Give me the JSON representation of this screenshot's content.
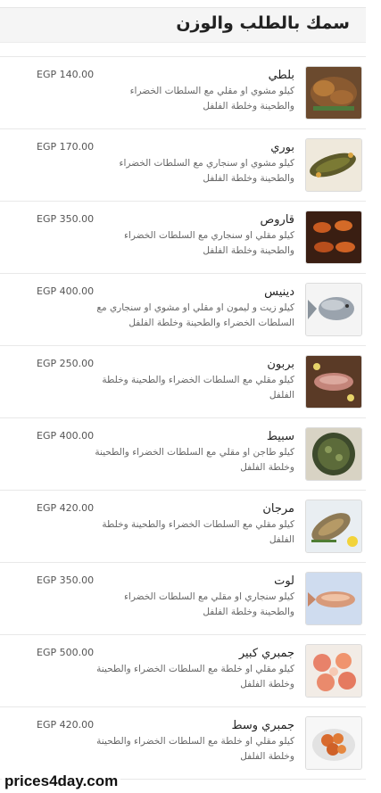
{
  "section": {
    "title": "سمك بالطلب والوزن"
  },
  "items": [
    {
      "name": "بلطي",
      "desc": "كيلو مشوي او مقلي مع السلطات الخضراء والطحينة وخلطة الفلفل",
      "price": "EGP 140.00",
      "icon": "tilapia-photo"
    },
    {
      "name": "بوري",
      "desc": "كيلو مشوي او سنجاري مع السلطات الخضراء والطحينة وخلطة الفلفل",
      "price": "EGP 170.00",
      "icon": "mullet-photo"
    },
    {
      "name": "قاروص",
      "desc": "كيلو مقلي او سنجاري مع السلطات الخضراء والطحينة وخلطة الفلفل",
      "price": "EGP 350.00",
      "icon": "seabass-photo"
    },
    {
      "name": "دينيس",
      "desc": "كيلو زيت و ليمون او مقلي او مشوي او سنجاري مع السلطات الخضراء والطحينة وخلطة الفلفل",
      "price": "EGP 400.00",
      "icon": "sea-bream-photo"
    },
    {
      "name": "بربون",
      "desc": "كيلو مقلي مع السلطات الخضراء والطحينة وخلطة الفلفل",
      "price": "EGP 250.00",
      "icon": "red-mullet-photo"
    },
    {
      "name": "سبيط",
      "desc": "كيلو طاجن او مقلي مع السلطات الخضراء والطحينة وخلطة الفلفل",
      "price": "EGP 400.00",
      "icon": "squid-photo"
    },
    {
      "name": "مرجان",
      "desc": "كيلو مقلي مع السلطات الخضراء والطحينة وخلطة الفلفل",
      "price": "EGP 420.00",
      "icon": "morgan-fish-photo"
    },
    {
      "name": "لوت",
      "desc": "كيلو سنجاري او مقلي مع السلطات الخضراء والطحينة وخلطة الفلفل",
      "price": "EGP 350.00",
      "icon": "lot-fish-photo"
    },
    {
      "name": "جمبري كبير",
      "desc": "كيلو مقلي او خلطة مع السلطات الخضراء والطحينة وخلطة الفلفل",
      "price": "EGP 500.00",
      "icon": "large-shrimp-photo"
    },
    {
      "name": "جمبري وسط",
      "desc": "كيلو مقلي او خلطة مع السلطات الخضراء والطحينة وخلطة الفلفل",
      "price": "EGP 420.00",
      "icon": "medium-shrimp-photo"
    }
  ],
  "watermark": "prices4day.com"
}
